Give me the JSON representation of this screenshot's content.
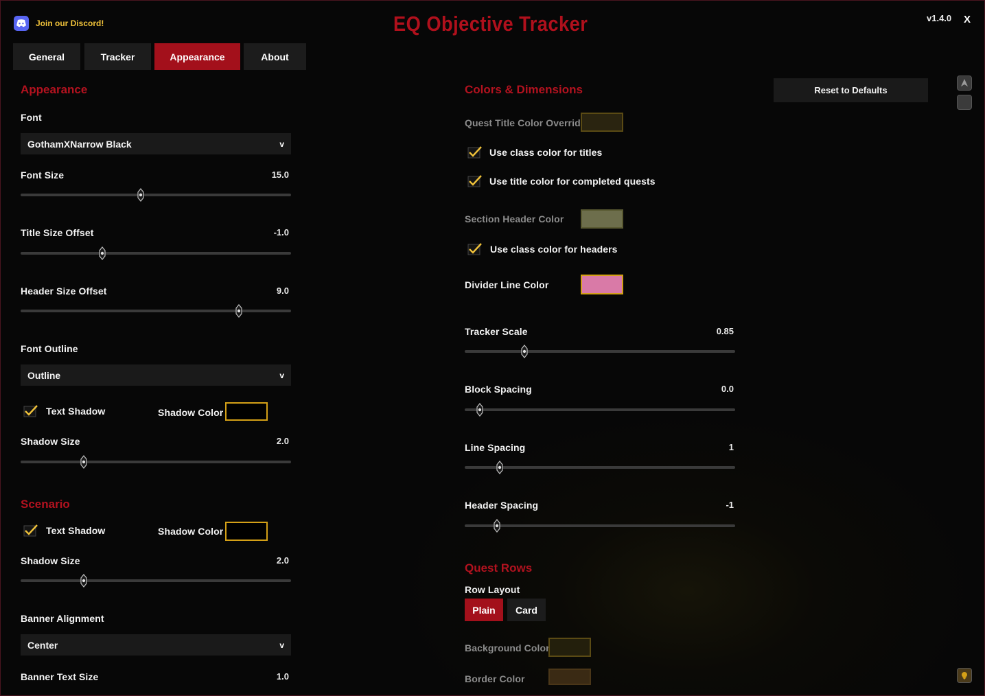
{
  "header": {
    "discord_label": "Join our Discord!",
    "title": "EQ Objective Tracker",
    "version": "v1.4.0",
    "close_label": "X"
  },
  "tabs": [
    {
      "label": "General",
      "active": false
    },
    {
      "label": "Tracker",
      "active": false
    },
    {
      "label": "Appearance",
      "active": true
    },
    {
      "label": "About",
      "active": false
    }
  ],
  "left": {
    "appearance_header": "Appearance",
    "font_label": "Font",
    "font_value": "GothamXNarrow Black",
    "font_size": {
      "label": "Font Size",
      "value": "15.0",
      "fraction": 0.445
    },
    "title_size_offset": {
      "label": "Title Size Offset",
      "value": "-1.0",
      "fraction": 0.303
    },
    "header_size_offset": {
      "label": "Header Size Offset",
      "value": "9.0",
      "fraction": 0.808
    },
    "font_outline_label": "Font Outline",
    "font_outline_value": "Outline",
    "text_shadow": {
      "label": "Text Shadow",
      "checked": true
    },
    "shadow_color_label": "Shadow Color",
    "shadow_color": "#000000",
    "shadow_size": {
      "label": "Shadow Size",
      "value": "2.0",
      "fraction": 0.233
    },
    "scenario_header": "Scenario",
    "scenario_text_shadow": {
      "label": "Text Shadow",
      "checked": true
    },
    "scenario_shadow_color_label": "Shadow Color",
    "scenario_shadow_color": "#000000",
    "scenario_shadow_size": {
      "label": "Shadow Size",
      "value": "2.0",
      "fraction": 0.233
    },
    "banner_alignment_label": "Banner Alignment",
    "banner_alignment_value": "Center",
    "banner_text_size": {
      "label": "Banner Text Size",
      "value": "1.0"
    }
  },
  "right": {
    "colors_header": "Colors & Dimensions",
    "reset_label": "Reset to Defaults",
    "quest_title_color_label": "Quest Title Color Override",
    "quest_title_color": "#2a2410",
    "use_class_color_titles": {
      "label": "Use class color for titles",
      "checked": true
    },
    "use_title_color_completed": {
      "label": "Use title color for completed quests",
      "checked": true
    },
    "section_header_color_label": "Section Header Color",
    "section_header_color": "#6d6e4c",
    "use_class_color_headers": {
      "label": "Use class color for headers",
      "checked": true
    },
    "divider_line_color_label": "Divider Line Color",
    "divider_line_color": "#d97aa7",
    "tracker_scale": {
      "label": "Tracker Scale",
      "value": "0.85",
      "fraction": 0.222
    },
    "block_spacing": {
      "label": "Block Spacing",
      "value": "0.0",
      "fraction": 0.055
    },
    "line_spacing": {
      "label": "Line Spacing",
      "value": "1",
      "fraction": 0.129
    },
    "header_spacing": {
      "label": "Header Spacing",
      "value": "-1",
      "fraction": 0.119
    },
    "quest_rows_header": "Quest Rows",
    "row_layout_label": "Row Layout",
    "row_layout_options": [
      {
        "label": "Plain",
        "active": true
      },
      {
        "label": "Card",
        "active": false
      }
    ],
    "background_color_label": "Background Color",
    "background_color": "#231f0c",
    "border_color_label": "Border Color",
    "border_color": "#3a2a14"
  },
  "colors": {
    "accent_red": "#a3101b",
    "section_red": "#b3121f",
    "check_yellow": "#f0c23a",
    "swatch_border": "#d4a017"
  },
  "icons": [
    "discord-icon",
    "checkmark-icon",
    "slider-knob-icon",
    "chevron-down-icon",
    "side-tool-icon"
  ]
}
